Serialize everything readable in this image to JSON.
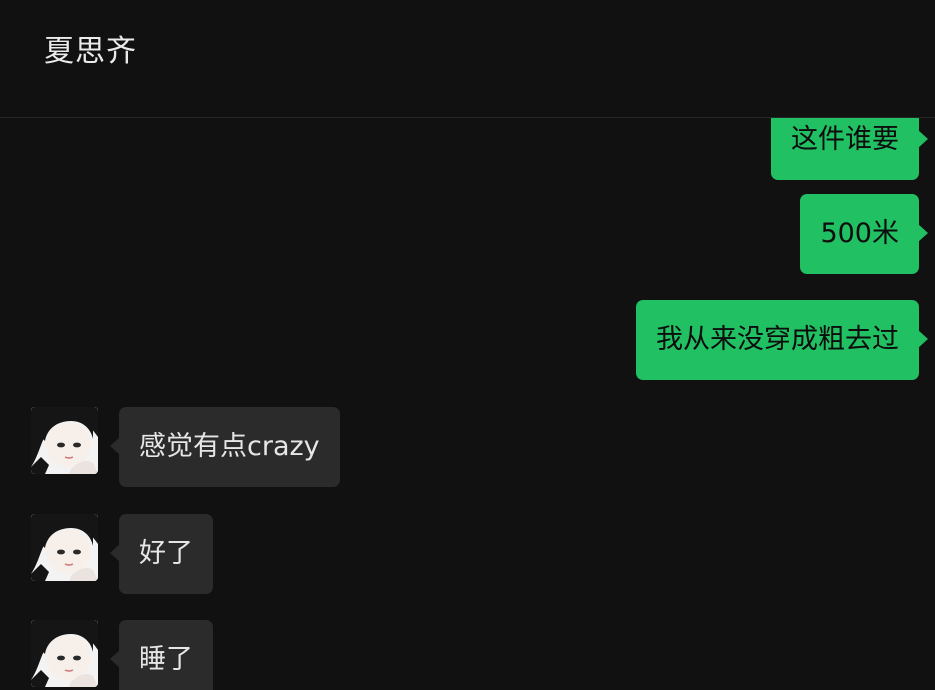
{
  "header": {
    "title": "夏思齐"
  },
  "messages": [
    {
      "direction": "outgoing",
      "text": "这件谁要"
    },
    {
      "direction": "outgoing",
      "text": "500米"
    },
    {
      "direction": "outgoing",
      "text": "我从来没穿成粗去过"
    },
    {
      "direction": "incoming",
      "text": "感觉有点crazy"
    },
    {
      "direction": "incoming",
      "text": "好了"
    },
    {
      "direction": "incoming",
      "text": "睡了"
    }
  ],
  "colors": {
    "background": "#111111",
    "outgoing_bubble": "#21c062",
    "incoming_bubble": "#2b2b2b",
    "title_text": "#ebebeb"
  },
  "icons": {
    "contact_avatar": "girl-portrait-avatar"
  }
}
